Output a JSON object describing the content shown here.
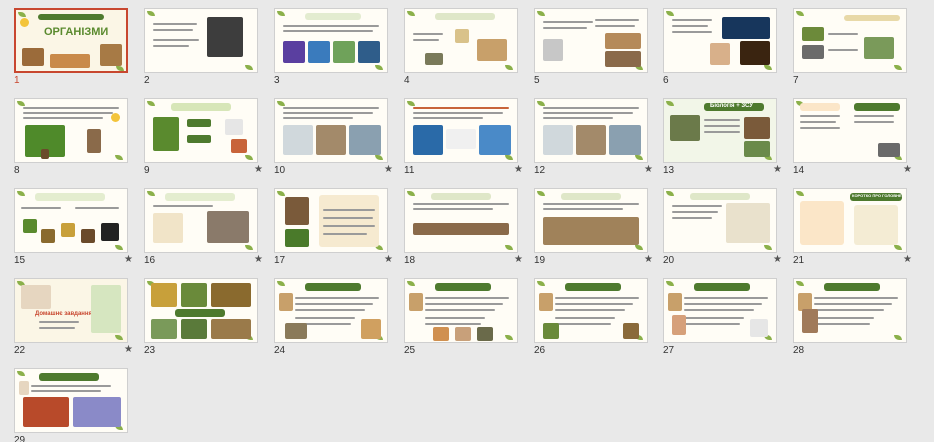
{
  "slides": [
    {
      "num": "1",
      "star": "",
      "selected": true,
      "heading": "ОРГАНІЗМИ",
      "kind": "title"
    },
    {
      "num": "2",
      "star": "",
      "selected": false,
      "heading": "",
      "kind": "portrait"
    },
    {
      "num": "3",
      "star": "",
      "selected": false,
      "heading": "Усі організми!",
      "kind": "pics4"
    },
    {
      "num": "4",
      "star": "",
      "selected": false,
      "heading": "",
      "kind": "animals"
    },
    {
      "num": "5",
      "star": "",
      "selected": false,
      "heading": "",
      "kind": "pics2"
    },
    {
      "num": "6",
      "star": "",
      "selected": false,
      "heading": "",
      "kind": "dark"
    },
    {
      "num": "7",
      "star": "",
      "selected": false,
      "heading": "",
      "kind": "scheme"
    },
    {
      "num": "8",
      "star": "",
      "selected": false,
      "heading": "",
      "kind": "tree"
    },
    {
      "num": "9",
      "star": "★",
      "selected": false,
      "heading": "",
      "kind": "tree2"
    },
    {
      "num": "10",
      "star": "★",
      "selected": false,
      "heading": "",
      "kind": "photos3"
    },
    {
      "num": "11",
      "star": "★",
      "selected": false,
      "heading": "",
      "kind": "blue"
    },
    {
      "num": "12",
      "star": "★",
      "selected": false,
      "heading": "",
      "kind": "photos3"
    },
    {
      "num": "13",
      "star": "★",
      "selected": false,
      "heading": "Біологія + ЗСУ",
      "kind": "green"
    },
    {
      "num": "14",
      "star": "★",
      "selected": false,
      "heading": "",
      "kind": "bird"
    },
    {
      "num": "15",
      "star": "★",
      "selected": false,
      "heading": "",
      "kind": "circles"
    },
    {
      "num": "16",
      "star": "★",
      "selected": false,
      "heading": "",
      "kind": "hamster"
    },
    {
      "num": "17",
      "star": "★",
      "selected": false,
      "heading": "",
      "kind": "scientist"
    },
    {
      "num": "18",
      "star": "★",
      "selected": false,
      "heading": "",
      "kind": "horses"
    },
    {
      "num": "19",
      "star": "★",
      "selected": false,
      "heading": "",
      "kind": "evolution"
    },
    {
      "num": "20",
      "star": "★",
      "selected": false,
      "heading": "",
      "kind": "diagram"
    },
    {
      "num": "21",
      "star": "★",
      "selected": false,
      "heading": "КОРОТКО ПРО ГОЛОВНЕ",
      "kind": "summary"
    },
    {
      "num": "22",
      "star": "★",
      "selected": false,
      "heading": "Домашнє завдання",
      "kind": "homework"
    },
    {
      "num": "23",
      "star": "",
      "selected": false,
      "heading": "",
      "kind": "worksheet"
    },
    {
      "num": "24",
      "star": "",
      "selected": false,
      "heading": "",
      "kind": "quiz"
    },
    {
      "num": "25",
      "star": "",
      "selected": false,
      "heading": "",
      "kind": "quiz2"
    },
    {
      "num": "26",
      "star": "",
      "selected": false,
      "heading": "",
      "kind": "quiz3"
    },
    {
      "num": "27",
      "star": "",
      "selected": false,
      "heading": "",
      "kind": "quiz4"
    },
    {
      "num": "28",
      "star": "",
      "selected": false,
      "heading": "",
      "kind": "quiz5"
    },
    {
      "num": "29",
      "star": "",
      "selected": false,
      "heading": "",
      "kind": "flowers"
    }
  ],
  "colors": {
    "background": "#e9e9e9",
    "selected_border": "#c8472f",
    "accent_green": "#4e7a2e",
    "slide_bg": "#fffdf6"
  }
}
